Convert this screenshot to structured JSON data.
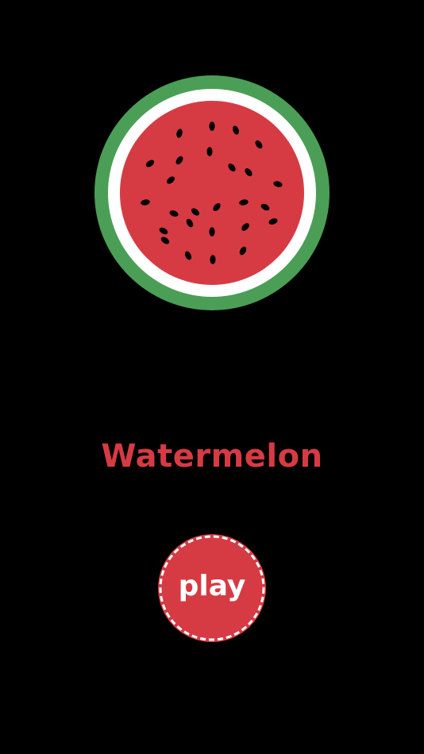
{
  "colors": {
    "background": "#000000",
    "rind": "#4b9e56",
    "pith": "#ffffff",
    "flesh": "#d63b44",
    "seed": "#000000",
    "title": "#d63b44",
    "button_fill": "#d63b44",
    "button_border": "#ffffff"
  },
  "hero": {
    "icon": "watermelon-slice-icon",
    "seed_count": 26
  },
  "title": {
    "text": "Watermelon"
  },
  "play_button": {
    "label": "play",
    "border_style": "dashed"
  }
}
